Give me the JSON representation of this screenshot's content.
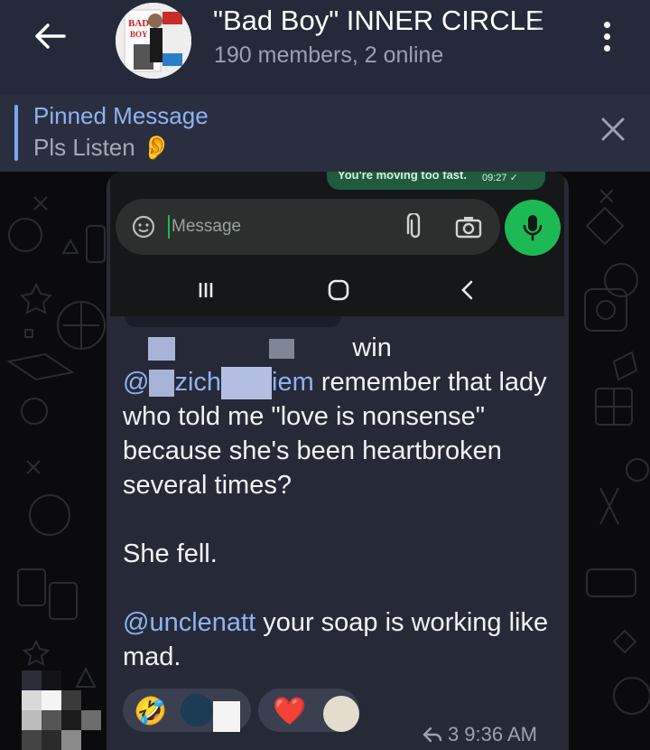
{
  "header": {
    "title": "\"Bad Boy\" INNER CIRCLE",
    "subtitle": "190 members, 2 online",
    "avatar_text": "BAD BOY"
  },
  "pinned": {
    "label": "Pinned Message",
    "text": "Pls Listen 👂"
  },
  "embedded_screenshot": {
    "bubble_text": "You're moving too fast.",
    "bubble_time": "09:27 ✓",
    "input_placeholder": "Message"
  },
  "message": {
    "line_fragment_1": "win",
    "mention_1a": "@",
    "mention_1b": "zich",
    "mention_1c": "iem",
    "text_1": "remember that lady who told me \"love is nonsense\" because she's been heartbroken several times?",
    "text_2": "She fell.",
    "mention_2": "@unclenatt",
    "text_3": "your soap is working like mad.",
    "reactions": [
      {
        "emoji": "🤣"
      },
      {
        "emoji": "❤️"
      }
    ],
    "reply_count": "3",
    "time": "9:36 AM"
  },
  "colors": {
    "header_bg": "#242a3a",
    "bubble_bg": "#262a37",
    "accent": "#8fb2f4",
    "mic_green": "#1db954"
  }
}
